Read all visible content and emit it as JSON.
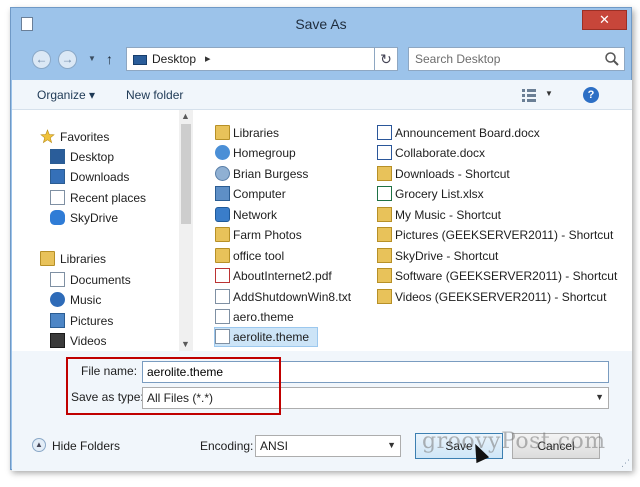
{
  "window": {
    "title": "Save As",
    "close_label": "✕"
  },
  "nav": {
    "back_icon": "back-arrow-icon",
    "forward_icon": "forward-arrow-icon",
    "address": "Desktop",
    "search_placeholder": "Search Desktop"
  },
  "toolbar": {
    "organize": "Organize ▾",
    "new_folder": "New folder"
  },
  "sidebar": {
    "favorites_header": "Favorites",
    "favorites": [
      "Desktop",
      "Downloads",
      "Recent places",
      "SkyDrive"
    ],
    "libraries_header": "Libraries",
    "libraries": [
      "Documents",
      "Music",
      "Pictures",
      "Videos"
    ]
  },
  "files": {
    "col1": [
      {
        "name": "Libraries",
        "icon": "folder-icon"
      },
      {
        "name": "Homegroup",
        "icon": "homegroup-icon"
      },
      {
        "name": "Brian Burgess",
        "icon": "user-folder-icon"
      },
      {
        "name": "Computer",
        "icon": "computer-icon"
      },
      {
        "name": "Network",
        "icon": "network-icon"
      },
      {
        "name": "Farm Photos",
        "icon": "folder-icon"
      },
      {
        "name": "office tool",
        "icon": "folder-icon"
      },
      {
        "name": "AboutInternet2.pdf",
        "icon": "pdf-file-icon"
      },
      {
        "name": "AddShutdownWin8.txt",
        "icon": "text-file-icon"
      },
      {
        "name": "aero.theme",
        "icon": "theme-file-icon"
      },
      {
        "name": "aerolite.theme",
        "icon": "theme-file-icon",
        "selected": true
      }
    ],
    "col2": [
      {
        "name": "Announcement Board.docx",
        "icon": "word-file-icon"
      },
      {
        "name": "Collaborate.docx",
        "icon": "word-file-icon"
      },
      {
        "name": "Downloads - Shortcut",
        "icon": "shortcut-icon"
      },
      {
        "name": "Grocery List.xlsx",
        "icon": "excel-file-icon"
      },
      {
        "name": "My Music - Shortcut",
        "icon": "shortcut-icon"
      },
      {
        "name": "Pictures (GEEKSERVER2011) - Shortcut",
        "icon": "shortcut-icon"
      },
      {
        "name": "SkyDrive - Shortcut",
        "icon": "shortcut-icon"
      },
      {
        "name": "Software (GEEKSERVER2011) - Shortcut",
        "icon": "shortcut-icon"
      },
      {
        "name": "Videos (GEEKSERVER2011) - Shortcut",
        "icon": "shortcut-icon"
      }
    ]
  },
  "form": {
    "file_name_label": "File name:",
    "file_name_value": "aerolite.theme",
    "save_type_label": "Save as type:",
    "save_type_value": "All Files  (*.*)",
    "hide_folders": "Hide Folders",
    "encoding_label": "Encoding:",
    "encoding_value": "ANSI",
    "save_button": "Save",
    "cancel_button": "Cancel",
    "watermark": "groovyPost.com"
  },
  "colors": {
    "frame": "#9cc3ea",
    "selection": "#cce4f7",
    "highlight_box": "#c00000",
    "close": "#c7463a"
  }
}
